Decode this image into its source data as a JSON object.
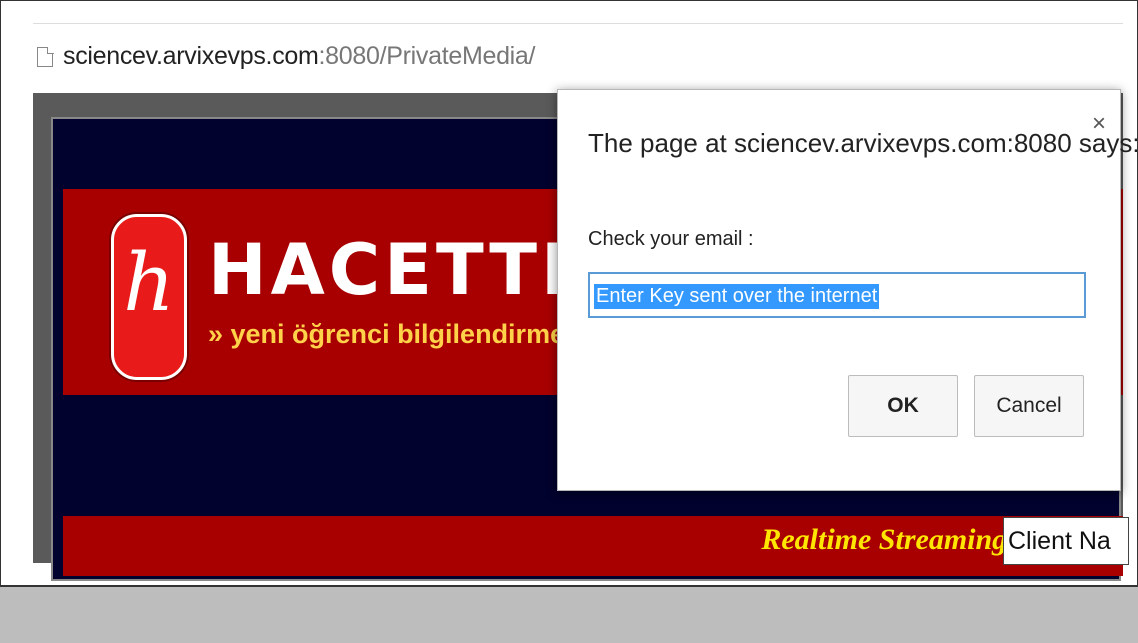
{
  "browser": {
    "url_host": "sciencev.arvixevps.com",
    "url_rest": ":8080/PrivateMedia/"
  },
  "page": {
    "banner_title": "HACETTEPE",
    "banner_subtitle": "» yeni öğrenci bilgilendirme sayfası",
    "stream_text": "Realtime Streaming P",
    "client_box_text": "Client Na"
  },
  "dialog": {
    "title": "The page at sciencev.arvixevps.com:8080 says:",
    "message": "Check your email :",
    "input_value": "Enter Key sent over the internet",
    "ok_label": "OK",
    "cancel_label": "Cancel",
    "close_glyph": "×"
  },
  "colors": {
    "banner_red": "#a80000",
    "page_navy": "#02022e",
    "stream_yellow": "#ffe600",
    "subtitle_yellow": "#ffd24a",
    "selection_blue": "#3399ff",
    "input_focus_border": "#5b9bd5"
  }
}
